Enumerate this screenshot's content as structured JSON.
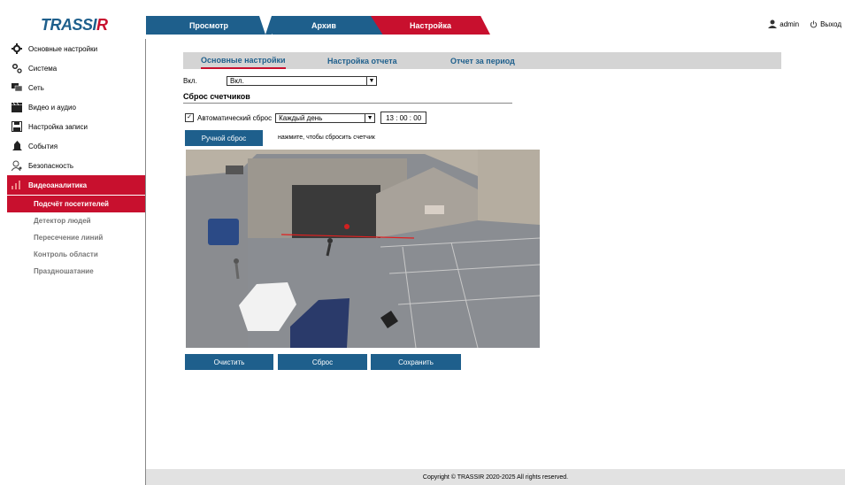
{
  "app": {
    "logo_text": "TRASSI",
    "logo_text_r": "R"
  },
  "topnav": {
    "tabs": [
      "Просмотр",
      "Архив",
      "Настройка"
    ],
    "active": 2
  },
  "user": {
    "name": "admin",
    "logout": "Выход"
  },
  "sidebar": {
    "items": [
      {
        "label": "Основные настройки",
        "icon": "gear-icon"
      },
      {
        "label": "Система",
        "icon": "system-gears-icon"
      },
      {
        "label": "Сеть",
        "icon": "network-icon"
      },
      {
        "label": "Видео и аудио",
        "icon": "video-icon"
      },
      {
        "label": "Настройка записи",
        "icon": "record-icon"
      },
      {
        "label": "События",
        "icon": "event-icon"
      },
      {
        "label": "Безопасность",
        "icon": "security-icon"
      },
      {
        "label": "Видеоаналитика",
        "icon": "analytics-icon"
      }
    ],
    "subitems": [
      "Подсчёт посетителей",
      "Детектор людей",
      "Пересечение линий",
      "Контроль области",
      "Праздношатание"
    ]
  },
  "subtabs": [
    "Основные настройки",
    "Настройка отчета",
    "Отчет за период"
  ],
  "form": {
    "enable_label": "Вкл.",
    "enable_value": "Вкл.",
    "section_title": "Сброс счетчиков",
    "auto_reset_label": "Автоматический сброс",
    "auto_reset_checked": true,
    "period_value": "Каждый день",
    "time_value": "13 : 00 : 00",
    "manual_reset": "Ручной сброс",
    "manual_hint": "нажмите, чтобы сбросить счетчик"
  },
  "buttons": {
    "clear": "Очистить",
    "reset": "Сброс",
    "save": "Сохранить"
  },
  "footer": "Copyright © TRASSIR 2020-2025 All rights reserved.",
  "colors": {
    "brand_blue": "#1e5f8c",
    "brand_red": "#c8102e",
    "subtab_bg": "#d4d4d4"
  }
}
